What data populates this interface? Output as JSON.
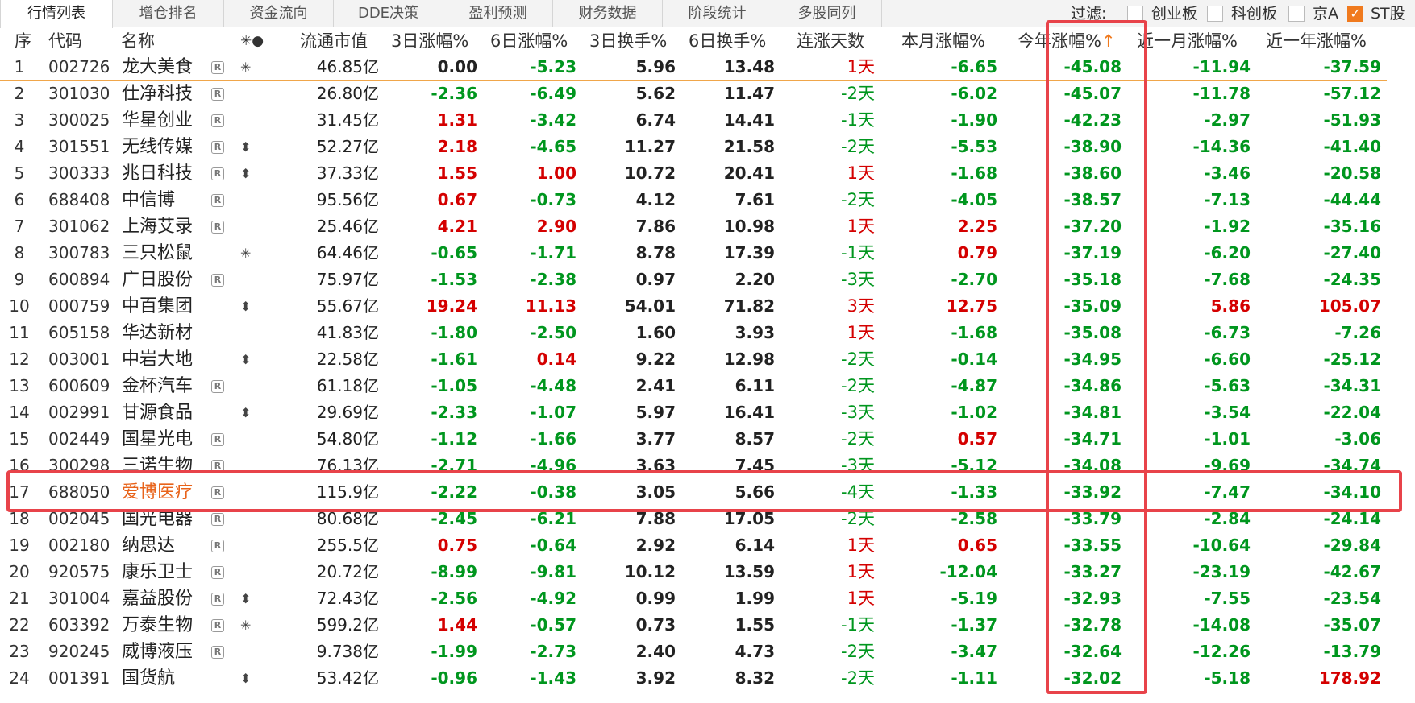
{
  "tabs": [
    "行情列表",
    "增仓排名",
    "资金流向",
    "DDE决策",
    "盈利预测",
    "财务数据",
    "阶段统计",
    "多股同列"
  ],
  "filter": {
    "label": "过滤:",
    "options": [
      {
        "label": "创业板",
        "checked": false
      },
      {
        "label": "科创板",
        "checked": false
      },
      {
        "label": "京A",
        "checked": false
      },
      {
        "label": "ST股",
        "checked": true
      }
    ]
  },
  "header": {
    "seq": "序",
    "code": "代码",
    "name": "名称",
    "marks": "✳●",
    "cap": "流通市值",
    "d3": "3日涨幅%",
    "d6": "6日涨幅%",
    "t3": "3日换手%",
    "t6": "6日换手%",
    "streak": "连涨天数",
    "month": "本月涨幅%",
    "ytd": "今年涨幅%",
    "ytd_sort": "↑",
    "m1": "近一月涨幅%",
    "y1": "近一年涨幅%"
  },
  "colors": {
    "red": "#d40000",
    "green": "#00961e",
    "orange": "#e8631a",
    "accent": "#f07a1e"
  },
  "rows": [
    {
      "seq": "1",
      "code": "002726",
      "name": "龙大美食",
      "r": true,
      "mark": "✳",
      "cap": "46.85亿",
      "d3": "0.00",
      "d6": "-5.23",
      "t3": "5.96",
      "t6": "13.48",
      "streak": "1天",
      "month": "-6.65",
      "ytd": "-45.08",
      "m1": "-11.94",
      "y1": "-37.59"
    },
    {
      "seq": "2",
      "code": "301030",
      "name": "仕净科技",
      "r": true,
      "mark": "",
      "cap": "26.80亿",
      "d3": "-2.36",
      "d6": "-6.49",
      "t3": "5.62",
      "t6": "11.47",
      "streak": "-2天",
      "month": "-6.02",
      "ytd": "-45.07",
      "m1": "-11.78",
      "y1": "-57.12"
    },
    {
      "seq": "3",
      "code": "300025",
      "name": "华星创业",
      "r": true,
      "mark": "",
      "cap": "31.45亿",
      "d3": "1.31",
      "d6": "-3.42",
      "t3": "6.74",
      "t6": "14.41",
      "streak": "-1天",
      "month": "-1.90",
      "ytd": "-42.23",
      "m1": "-2.97",
      "y1": "-51.93"
    },
    {
      "seq": "4",
      "code": "301551",
      "name": "无线传媒",
      "r": true,
      "mark": "⬍",
      "cap": "52.27亿",
      "d3": "2.18",
      "d6": "-4.65",
      "t3": "11.27",
      "t6": "21.58",
      "streak": "-2天",
      "month": "-5.53",
      "ytd": "-38.90",
      "m1": "-14.36",
      "y1": "-41.40"
    },
    {
      "seq": "5",
      "code": "300333",
      "name": "兆日科技",
      "r": true,
      "mark": "⬍",
      "cap": "37.33亿",
      "d3": "1.55",
      "d6": "1.00",
      "t3": "10.72",
      "t6": "20.41",
      "streak": "1天",
      "month": "-1.68",
      "ytd": "-38.60",
      "m1": "-3.46",
      "y1": "-20.58"
    },
    {
      "seq": "6",
      "code": "688408",
      "name": "中信博",
      "r": true,
      "mark": "",
      "cap": "95.56亿",
      "d3": "0.67",
      "d6": "-0.73",
      "t3": "4.12",
      "t6": "7.61",
      "streak": "-2天",
      "month": "-4.05",
      "ytd": "-38.57",
      "m1": "-7.13",
      "y1": "-44.44"
    },
    {
      "seq": "7",
      "code": "301062",
      "name": "上海艾录",
      "r": true,
      "mark": "",
      "cap": "25.46亿",
      "d3": "4.21",
      "d6": "2.90",
      "t3": "7.86",
      "t6": "10.98",
      "streak": "1天",
      "month": "2.25",
      "ytd": "-37.20",
      "m1": "-1.92",
      "y1": "-35.16"
    },
    {
      "seq": "8",
      "code": "300783",
      "name": "三只松鼠",
      "r": false,
      "mark": "✳",
      "cap": "64.46亿",
      "d3": "-0.65",
      "d6": "-1.71",
      "t3": "8.78",
      "t6": "17.39",
      "streak": "-1天",
      "month": "0.79",
      "ytd": "-37.19",
      "m1": "-6.20",
      "y1": "-27.40"
    },
    {
      "seq": "9",
      "code": "600894",
      "name": "广日股份",
      "r": true,
      "mark": "",
      "cap": "75.97亿",
      "d3": "-1.53",
      "d6": "-2.38",
      "t3": "0.97",
      "t6": "2.20",
      "streak": "-3天",
      "month": "-2.70",
      "ytd": "-35.18",
      "m1": "-7.68",
      "y1": "-24.35"
    },
    {
      "seq": "10",
      "code": "000759",
      "name": "中百集团",
      "r": false,
      "mark": "⬍",
      "cap": "55.67亿",
      "d3": "19.24",
      "d6": "11.13",
      "t3": "54.01",
      "t6": "71.82",
      "streak": "3天",
      "month": "12.75",
      "ytd": "-35.09",
      "m1": "5.86",
      "y1": "105.07"
    },
    {
      "seq": "11",
      "code": "605158",
      "name": "华达新材",
      "r": false,
      "mark": "",
      "cap": "41.83亿",
      "d3": "-1.80",
      "d6": "-2.50",
      "t3": "1.60",
      "t6": "3.93",
      "streak": "1天",
      "month": "-1.68",
      "ytd": "-35.08",
      "m1": "-6.73",
      "y1": "-7.26"
    },
    {
      "seq": "12",
      "code": "003001",
      "name": "中岩大地",
      "r": false,
      "mark": "⬍",
      "cap": "22.58亿",
      "d3": "-1.61",
      "d6": "0.14",
      "t3": "9.22",
      "t6": "12.98",
      "streak": "-2天",
      "month": "-0.14",
      "ytd": "-34.95",
      "m1": "-6.60",
      "y1": "-25.12"
    },
    {
      "seq": "13",
      "code": "600609",
      "name": "金杯汽车",
      "r": true,
      "mark": "",
      "cap": "61.18亿",
      "d3": "-1.05",
      "d6": "-4.48",
      "t3": "2.41",
      "t6": "6.11",
      "streak": "-2天",
      "month": "-4.87",
      "ytd": "-34.86",
      "m1": "-5.63",
      "y1": "-34.31"
    },
    {
      "seq": "14",
      "code": "002991",
      "name": "甘源食品",
      "r": false,
      "mark": "⬍",
      "cap": "29.69亿",
      "d3": "-2.33",
      "d6": "-1.07",
      "t3": "5.97",
      "t6": "16.41",
      "streak": "-3天",
      "month": "-1.02",
      "ytd": "-34.81",
      "m1": "-3.54",
      "y1": "-22.04"
    },
    {
      "seq": "15",
      "code": "002449",
      "name": "国星光电",
      "r": true,
      "mark": "",
      "cap": "54.80亿",
      "d3": "-1.12",
      "d6": "-1.66",
      "t3": "3.77",
      "t6": "8.57",
      "streak": "-2天",
      "month": "0.57",
      "ytd": "-34.71",
      "m1": "-1.01",
      "y1": "-3.06"
    },
    {
      "seq": "16",
      "code": "300298",
      "name": "三诺生物",
      "r": true,
      "mark": "",
      "cap": "76.13亿",
      "d3": "-2.71",
      "d6": "-4.96",
      "t3": "3.63",
      "t6": "7.45",
      "streak": "-3天",
      "month": "-5.12",
      "ytd": "-34.08",
      "m1": "-9.69",
      "y1": "-34.74"
    },
    {
      "seq": "17",
      "code": "688050",
      "name": "爱博医疗",
      "r": true,
      "mark": "",
      "cap": "115.9亿",
      "d3": "-2.22",
      "d6": "-0.38",
      "t3": "3.05",
      "t6": "5.66",
      "streak": "-4天",
      "month": "-1.33",
      "ytd": "-33.92",
      "m1": "-7.47",
      "y1": "-34.10",
      "highlight": true
    },
    {
      "seq": "18",
      "code": "002045",
      "name": "国光电器",
      "r": true,
      "mark": "",
      "cap": "80.68亿",
      "d3": "-2.45",
      "d6": "-6.21",
      "t3": "7.88",
      "t6": "17.05",
      "streak": "-2天",
      "month": "-2.58",
      "ytd": "-33.79",
      "m1": "-2.84",
      "y1": "-24.14"
    },
    {
      "seq": "19",
      "code": "002180",
      "name": "纳思达",
      "r": true,
      "mark": "",
      "cap": "255.5亿",
      "d3": "0.75",
      "d6": "-0.64",
      "t3": "2.92",
      "t6": "6.14",
      "streak": "1天",
      "month": "0.65",
      "ytd": "-33.55",
      "m1": "-10.64",
      "y1": "-29.84"
    },
    {
      "seq": "20",
      "code": "920575",
      "name": "康乐卫士",
      "r": true,
      "mark": "",
      "cap": "20.72亿",
      "d3": "-8.99",
      "d6": "-9.81",
      "t3": "10.12",
      "t6": "13.59",
      "streak": "1天",
      "month": "-12.04",
      "ytd": "-33.27",
      "m1": "-23.19",
      "y1": "-42.67"
    },
    {
      "seq": "21",
      "code": "301004",
      "name": "嘉益股份",
      "r": true,
      "mark": "⬍",
      "cap": "72.43亿",
      "d3": "-2.56",
      "d6": "-4.92",
      "t3": "0.99",
      "t6": "1.99",
      "streak": "1天",
      "month": "-5.19",
      "ytd": "-32.93",
      "m1": "-7.55",
      "y1": "-23.54"
    },
    {
      "seq": "22",
      "code": "603392",
      "name": "万泰生物",
      "r": true,
      "mark": "✳",
      "cap": "599.2亿",
      "d3": "1.44",
      "d6": "-0.57",
      "t3": "0.73",
      "t6": "1.55",
      "streak": "-1天",
      "month": "-1.37",
      "ytd": "-32.78",
      "m1": "-14.08",
      "y1": "-35.07"
    },
    {
      "seq": "23",
      "code": "920245",
      "name": "威博液压",
      "r": true,
      "mark": "",
      "cap": "9.738亿",
      "d3": "-1.99",
      "d6": "-2.73",
      "t3": "2.40",
      "t6": "4.73",
      "streak": "-2天",
      "month": "-3.47",
      "ytd": "-32.64",
      "m1": "-12.26",
      "y1": "-13.79"
    },
    {
      "seq": "24",
      "code": "001391",
      "name": "国货航",
      "r": false,
      "mark": "⬍",
      "cap": "53.42亿",
      "d3": "-0.96",
      "d6": "-1.43",
      "t3": "3.92",
      "t6": "8.32",
      "streak": "-2天",
      "month": "-1.11",
      "ytd": "-32.02",
      "m1": "-5.18",
      "y1": "178.92"
    }
  ]
}
